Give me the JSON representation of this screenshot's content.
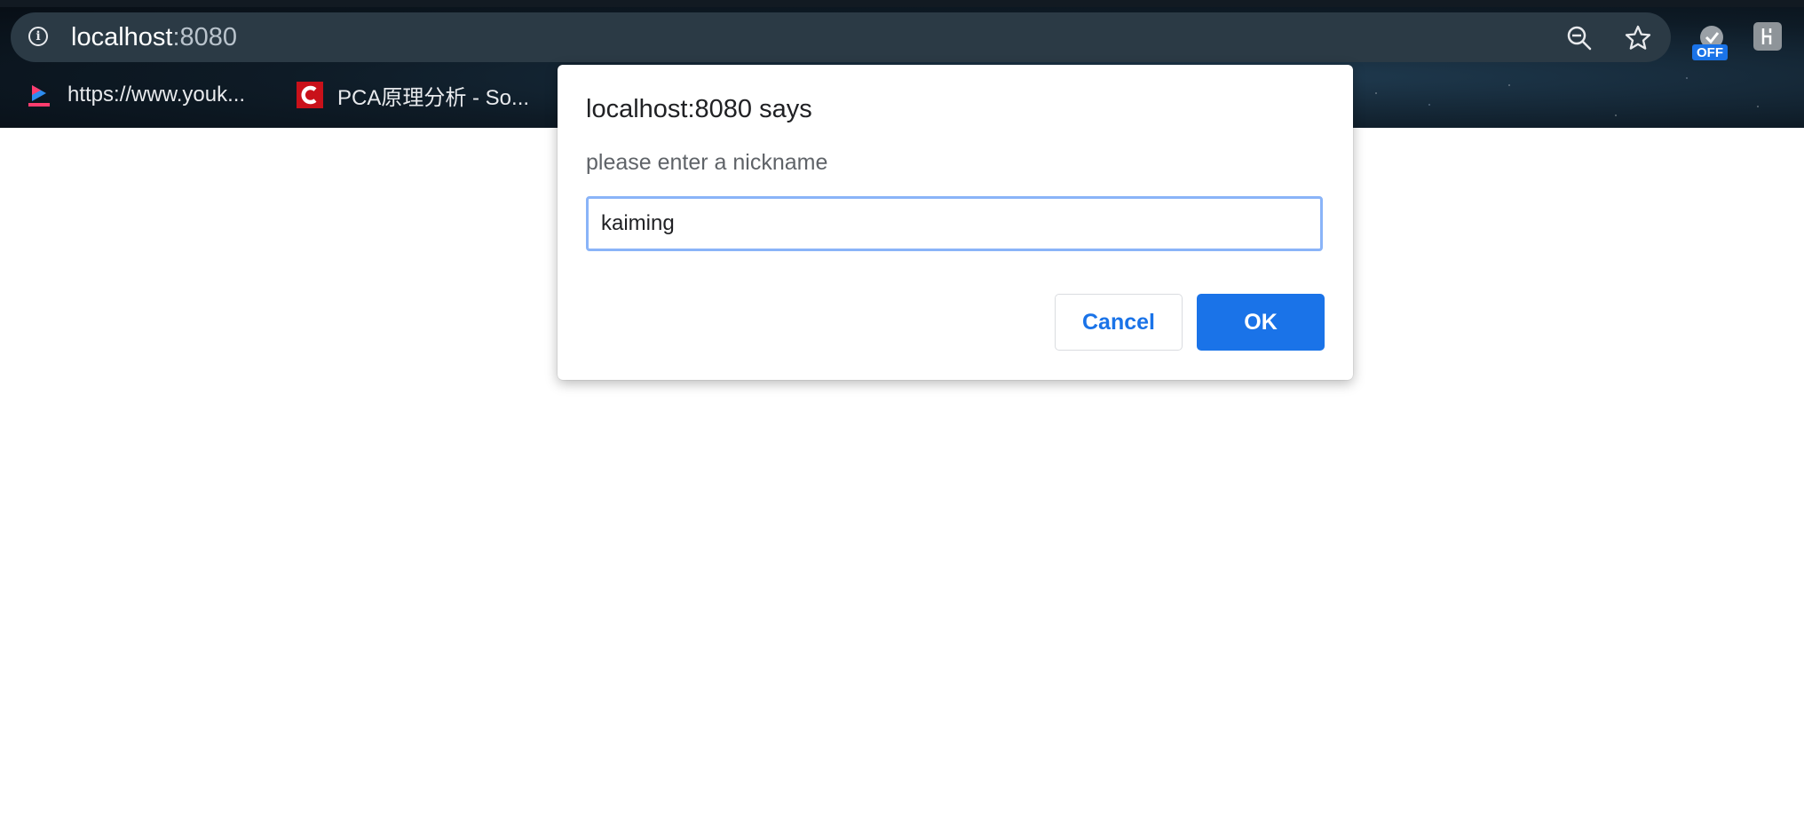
{
  "browser": {
    "url_host": "localhost",
    "url_port": ":8080",
    "extension_badge": "OFF",
    "icons": [
      "info-icon",
      "zoom-out-icon",
      "star-icon",
      "extension-icon",
      "extension-icon-2"
    ],
    "bookmarks": [
      {
        "label": "https://www.youk...",
        "icon": "youku-favicon"
      },
      {
        "label": "PCA原理分析 - So...",
        "icon": "csdn-favicon"
      }
    ]
  },
  "dialog": {
    "title": "localhost:8080 says",
    "message": "please enter a nickname",
    "input_value": "kaiming",
    "cancel_label": "Cancel",
    "ok_label": "OK"
  },
  "colors": {
    "accent": "#1a73e8",
    "input_focus": "#8ab4f8",
    "omnibox": "#2b3a45",
    "chrome_bg": "#0e1b26",
    "csdn_red": "#c9111a"
  }
}
